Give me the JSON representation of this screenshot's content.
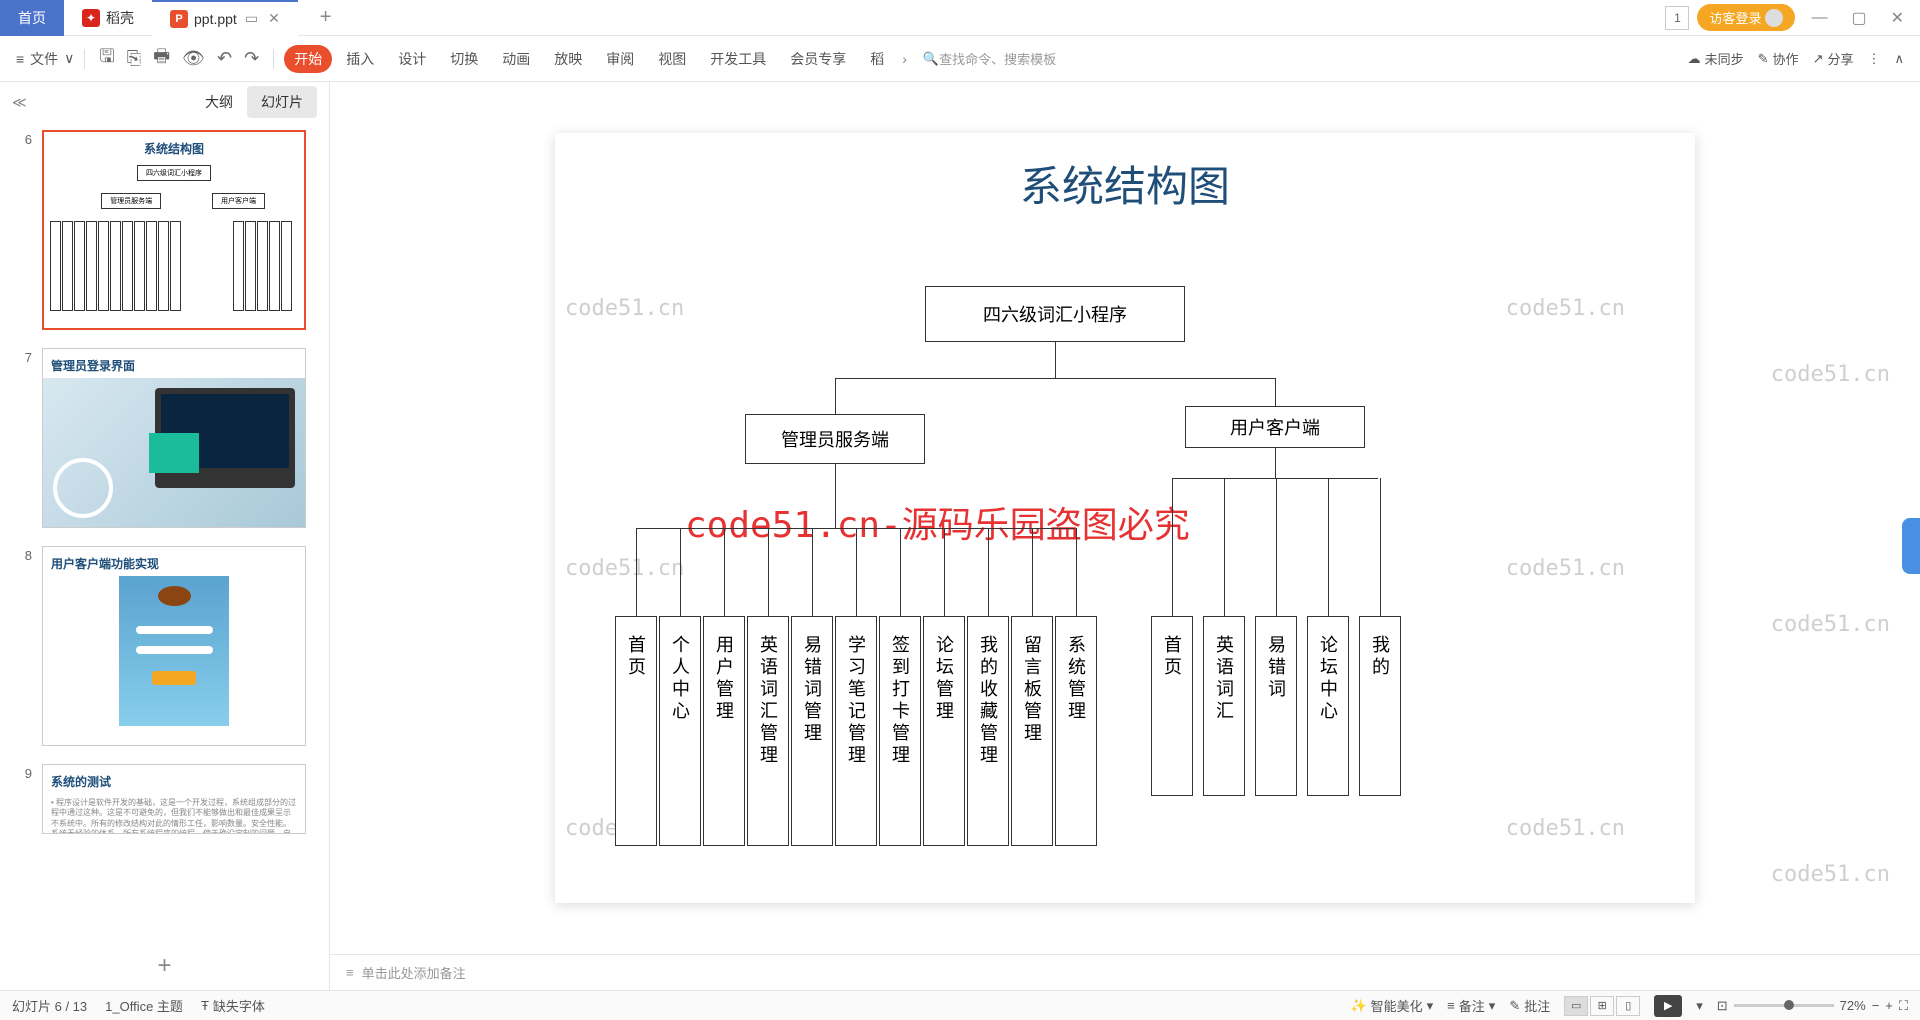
{
  "titlebar": {
    "home": "首页",
    "docker": "稻壳",
    "file": "ppt.ppt",
    "login": "访客登录"
  },
  "toolbar": {
    "file_menu": "文件",
    "tabs": [
      "开始",
      "插入",
      "设计",
      "切换",
      "动画",
      "放映",
      "审阅",
      "视图",
      "开发工具",
      "会员专享",
      "稻"
    ],
    "search_placeholder": "查找命令、搜索模板",
    "unsync": "未同步",
    "collab": "协作",
    "share": "分享"
  },
  "sidepanel": {
    "outline": "大纲",
    "slides": "幻灯片",
    "thumbs": [
      {
        "num": "6",
        "title": "系统结构图"
      },
      {
        "num": "7",
        "title": "管理员登录界面"
      },
      {
        "num": "8",
        "title": "用户客户端功能实现"
      },
      {
        "num": "9",
        "title": "系统的测试"
      }
    ],
    "add": "+"
  },
  "slide": {
    "title": "系统结构图",
    "root": "四六级词汇小程序",
    "l2": [
      "管理员服务端",
      "用户客户端"
    ],
    "admin_children": [
      "首页",
      "个人中心",
      "用户管理",
      "英语词汇管理",
      "易错词管理",
      "学习笔记管理",
      "签到打卡管理",
      "论坛管理",
      "我的收藏管理",
      "留言板管理",
      "系统管理"
    ],
    "user_children": [
      "首页",
      "英语词汇",
      "易错词",
      "论坛中心",
      "我的"
    ],
    "watermarks": [
      "code51.cn",
      "code51.cn",
      "code51.cn",
      "code51.cn",
      "code51.cn",
      "code51.cn"
    ],
    "red_wm": "code51.cn-源码乐园盗图必究"
  },
  "outer_watermarks": [
    "code51.cn",
    "code51.cn",
    "code51.cn"
  ],
  "notes": "单击此处添加备注",
  "statusbar": {
    "slide_info": "幻灯片 6 / 13",
    "theme": "1_Office 主题",
    "missing_font": "缺失字体",
    "beautify": "智能美化",
    "notes_btn": "备注",
    "comments": "批注",
    "zoom": "72%"
  }
}
